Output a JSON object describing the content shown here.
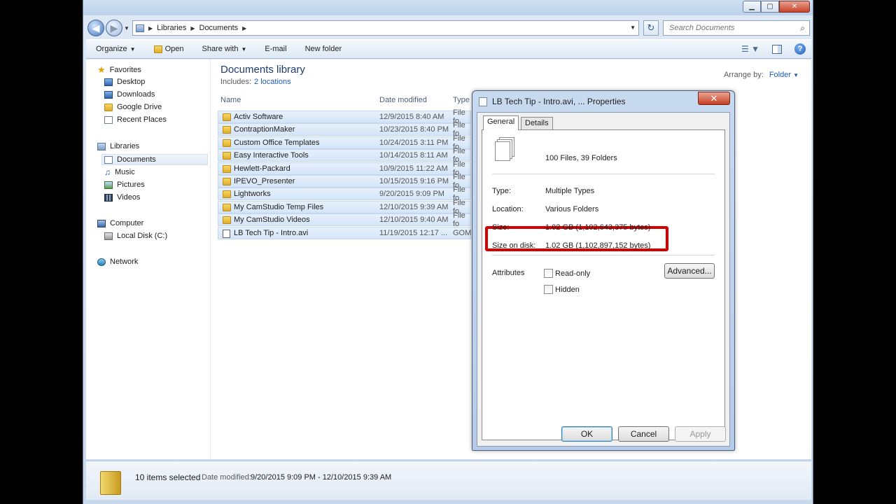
{
  "address": {
    "segments": [
      "Libraries",
      "Documents"
    ],
    "search_placeholder": "Search Documents"
  },
  "toolbar": {
    "organize": "Organize",
    "open": "Open",
    "share_with": "Share with",
    "email": "E-mail",
    "new_folder": "New folder"
  },
  "nav": {
    "favorites": "Favorites",
    "favorites_items": [
      "Desktop",
      "Downloads",
      "Google Drive",
      "Recent Places"
    ],
    "libraries": "Libraries",
    "libraries_items": [
      "Documents",
      "Music",
      "Pictures",
      "Videos"
    ],
    "computer": "Computer",
    "computer_items": [
      "Local Disk (C:)"
    ],
    "network": "Network"
  },
  "library": {
    "title": "Documents library",
    "includes_label": "Includes:",
    "includes_link": "2 locations",
    "arrange_label": "Arrange by:",
    "arrange_value": "Folder"
  },
  "columns": {
    "name": "Name",
    "date": "Date modified",
    "type": "Type"
  },
  "files": [
    {
      "name": "Activ Software",
      "date": "12/9/2015 8:40 AM",
      "type": "File fo"
    },
    {
      "name": "ContraptionMaker",
      "date": "10/23/2015 8:40 PM",
      "type": "File fo"
    },
    {
      "name": "Custom Office Templates",
      "date": "10/24/2015 3:11 PM",
      "type": "File fo"
    },
    {
      "name": "Easy Interactive Tools",
      "date": "10/14/2015 8:11 AM",
      "type": "File fo"
    },
    {
      "name": "Hewlett-Packard",
      "date": "10/9/2015 11:22 AM",
      "type": "File fo"
    },
    {
      "name": "IPEVO_Presenter",
      "date": "10/15/2015 9:16 PM",
      "type": "File fo"
    },
    {
      "name": "Lightworks",
      "date": "9/20/2015 9:09 PM",
      "type": "File fo"
    },
    {
      "name": "My CamStudio Temp Files",
      "date": "12/10/2015 9:39 AM",
      "type": "File fo"
    },
    {
      "name": "My CamStudio Videos",
      "date": "12/10/2015 9:40 AM",
      "type": "File fo"
    },
    {
      "name": "LB Tech Tip - Intro.avi",
      "date": "11/19/2015 12:17 ...",
      "type": "GOM"
    }
  ],
  "status": {
    "selected": "10 items selected",
    "date_label": "Date modified:",
    "date_range": "9/20/2015 9:09 PM - 12/10/2015 9:39 AM"
  },
  "dialog": {
    "title": "LB Tech Tip - Intro.avi, ... Properties",
    "close": "✕",
    "tabs": [
      "General",
      "Details"
    ],
    "summary": "100 Files, 39 Folders",
    "type_label": "Type:",
    "type_value": "Multiple Types",
    "location_label": "Location:",
    "location_value": "Various Folders",
    "size_label": "Size:",
    "size_value": "1.02 GB (1,102,643,375 bytes)",
    "size_disk_label": "Size on disk:",
    "size_disk_value": "1.02 GB (1,102,897,152 bytes)",
    "attributes_label": "Attributes",
    "readonly": "Read-only",
    "hidden": "Hidden",
    "advanced": "Advanced...",
    "ok": "OK",
    "cancel": "Cancel",
    "apply": "Apply"
  }
}
